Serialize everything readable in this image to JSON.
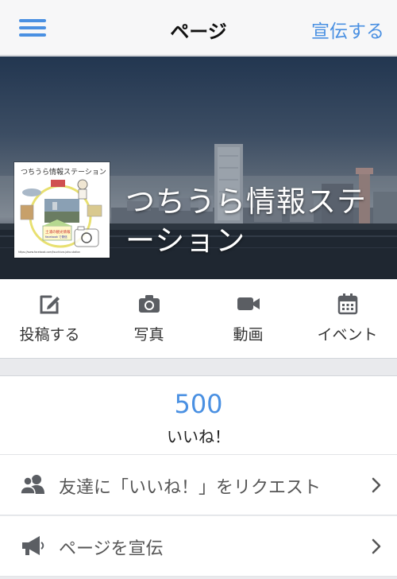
{
  "nav": {
    "title": "ページ",
    "action_label": "宣伝する",
    "menu_icon": "hamburger-menu-icon",
    "accent_color": "#4a90e2"
  },
  "cover": {
    "page_name": "つちうら情報ステーション",
    "profile_image": {
      "alt": "page-profile-logo",
      "logo_text": "つちうら情報ステーション",
      "inner_badge_text": "土浦の観光情報",
      "inner_badge_sub": "facebook で発信",
      "footer_text": "https://www.facebook.com/tsuchiura.joho.station"
    }
  },
  "actions": [
    {
      "label": "投稿する",
      "icon": "compose-icon"
    },
    {
      "label": "写真",
      "icon": "camera-icon"
    },
    {
      "label": "動画",
      "icon": "video-camera-icon"
    },
    {
      "label": "イベント",
      "icon": "calendar-icon"
    }
  ],
  "likes": {
    "count": "500",
    "label": "いいね！"
  },
  "rows": [
    {
      "label": "友達に「いいね！」をリクエスト",
      "icon": "friends-icon"
    },
    {
      "label": "ページを宣伝",
      "icon": "megaphone-icon"
    }
  ]
}
